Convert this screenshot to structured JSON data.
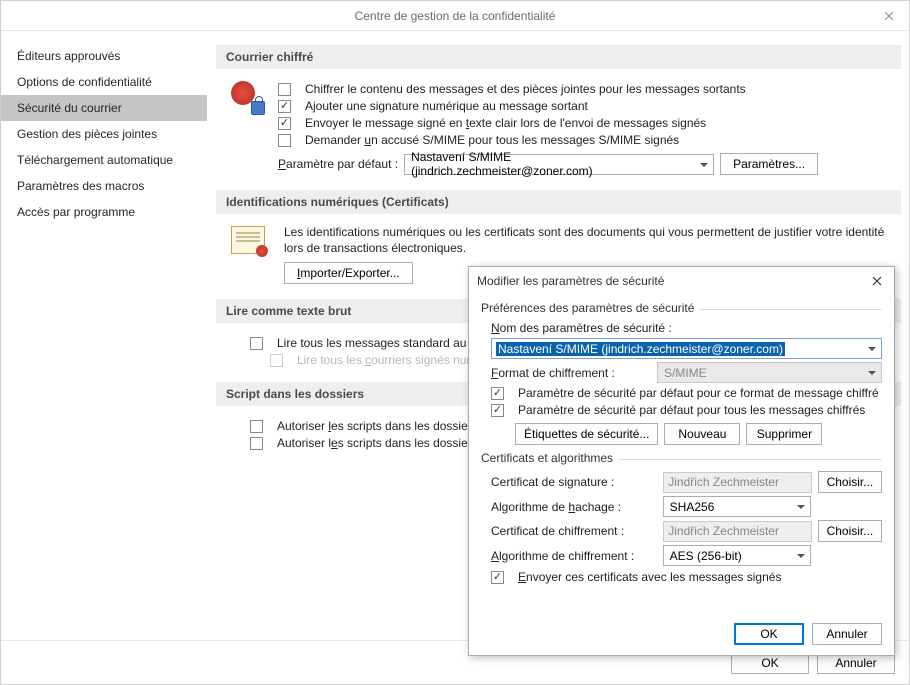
{
  "window": {
    "title": "Centre de gestion de la confidentialité",
    "ok": "OK",
    "cancel": "Annuler"
  },
  "sidebar": {
    "items": [
      {
        "label": "Éditeurs approuvés"
      },
      {
        "label": "Options de confidentialité"
      },
      {
        "label": "Sécurité du courrier"
      },
      {
        "label": "Gestion des pièces jointes"
      },
      {
        "label": "Téléchargement automatique"
      },
      {
        "label": "Paramètres des macros"
      },
      {
        "label": "Accès par programme"
      }
    ],
    "active_index": 2
  },
  "groups": {
    "encrypted_mail": {
      "header": "Courrier chiffré",
      "opt_encrypt": "Chiffrer le contenu des messages et des pièces jointes pour les messages sortants",
      "opt_sign": "Ajouter une signature numérique au message sortant",
      "opt_cleartext": "Envoyer le message signé en texte clair lors de l'envoi de messages signés",
      "opt_receipt": "Demander un accusé S/MIME pour tous les messages S/MIME signés",
      "default_param_label_pre": "Paramètre par défaut :",
      "default_param_value": "Nastavení S/MIME (jindrich.zechmeister@zoner.com)",
      "settings_btn": "Paramètres..."
    },
    "digital_ids": {
      "header": "Identifications numériques (Certificats)",
      "desc": "Les identifications numériques ou les certificats sont des documents qui vous permettent de justifier votre identité lors de transactions électroniques.",
      "import_btn": "Importer/Exporter..."
    },
    "plaintext": {
      "header": "Lire comme texte brut",
      "opt_standard": "Lire tous les messages standard au format",
      "opt_signed": "Lire tous les courriers signés numériq"
    },
    "script": {
      "header": "Script dans les dossiers",
      "opt_shared": "Autoriser les scripts dans les dossiers parta",
      "opt_public": "Autoriser les scripts dans les dossiers publ"
    }
  },
  "modal": {
    "title": "Modifier les paramètres de sécurité",
    "prefs_header": "Préférences des paramètres de sécurité",
    "name_label": "Nom des paramètres de sécurité :",
    "name_value": "Nastavení S/MIME (jindrich.zechmeister@zoner.com)",
    "format_label": "Format de chiffrement :",
    "format_value": "S/MIME",
    "opt_default_format": "Paramètre de sécurité par défaut pour ce format de message chiffré",
    "opt_default_all": "Paramètre de sécurité par défaut pour tous les messages chiffrés",
    "btn_labels": "Étiquettes de sécurité...",
    "btn_new": "Nouveau",
    "btn_delete": "Supprimer",
    "certs_header": "Certificats et algorithmes",
    "sign_cert_label": "Certificat de signature :",
    "sign_cert_value": "Jindřich Zechmeister",
    "hash_label": "Algorithme de hachage :",
    "hash_value": "SHA256",
    "enc_cert_label": "Certificat de chiffrement :",
    "enc_cert_value": "Jindřich Zechmeister",
    "enc_algo_label": "Algorithme de chiffrement :",
    "enc_algo_value": "AES (256-bit)",
    "choose_btn": "Choisir...",
    "opt_send_certs": "Envoyer ces certificats avec les messages signés",
    "ok": "OK",
    "cancel": "Annuler"
  }
}
